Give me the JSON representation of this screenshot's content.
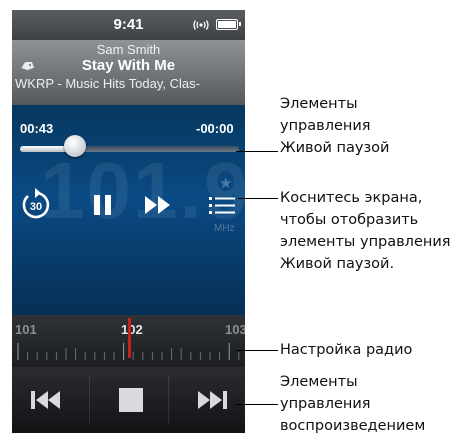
{
  "status_bar": {
    "time": "9:41"
  },
  "now_playing": {
    "artist": "Sam Smith",
    "song": "Stay With Me",
    "station": "WKRP - Music Hits Today, Clas-"
  },
  "live_pause": {
    "elapsed": "00:43",
    "remaining": "-00:00",
    "progress_fraction": 0.25,
    "skip_back_seconds": "30"
  },
  "frequency_display": {
    "value": "101.9",
    "unit": "MHz"
  },
  "tuner": {
    "scale_labels": [
      "101",
      "102",
      "103"
    ],
    "current_frequency": "102"
  },
  "callouts": [
    {
      "lines": [
        "Элементы",
        "управления",
        "Живой паузой"
      ]
    },
    {
      "lines": [
        "Коснитесь экрана,",
        "чтобы отобразить",
        "элементы управления",
        "Живой паузой."
      ]
    },
    {
      "lines": [
        "Настройка радио"
      ]
    },
    {
      "lines": [
        "Элементы",
        "управления",
        "воспроизведением"
      ]
    }
  ],
  "colors": {
    "panel_blue": "#0a4a84",
    "tuner_needle": "#c8211f",
    "status_bar": "#3d4146"
  }
}
